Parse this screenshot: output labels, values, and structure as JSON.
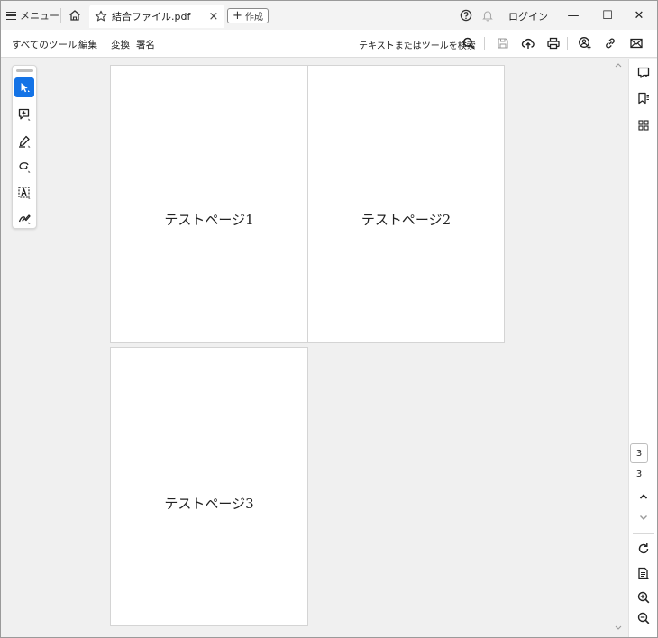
{
  "titlebar": {
    "menu_label": "メニュー",
    "tab_title": "結合ファイル.pdf",
    "tab_close": "×",
    "new_tab_plus": "+",
    "new_tab_label": "作成",
    "login_label": "ログイン",
    "minimize": "—",
    "maximize": "☐",
    "close": "✕"
  },
  "toolbar": {
    "menus": [
      "すべてのツール",
      "編集",
      "変換",
      "署名"
    ],
    "search_label": "テキストまたはツールを検索"
  },
  "pages": [
    {
      "label": "テストページ1"
    },
    {
      "label": "テストページ2"
    },
    {
      "label": "テストページ3"
    }
  ],
  "palette": {
    "tools": [
      "select-tool",
      "add-comment-tool",
      "highlight-tool",
      "draw-freeform-tool",
      "select-text-tool",
      "fill-sign-tool"
    ],
    "active_tool": "select-tool"
  },
  "rail": {
    "current_page": "3",
    "total_pages": "3"
  },
  "colors": {
    "accent": "#1473e6",
    "canvas": "#f0f0f0"
  }
}
